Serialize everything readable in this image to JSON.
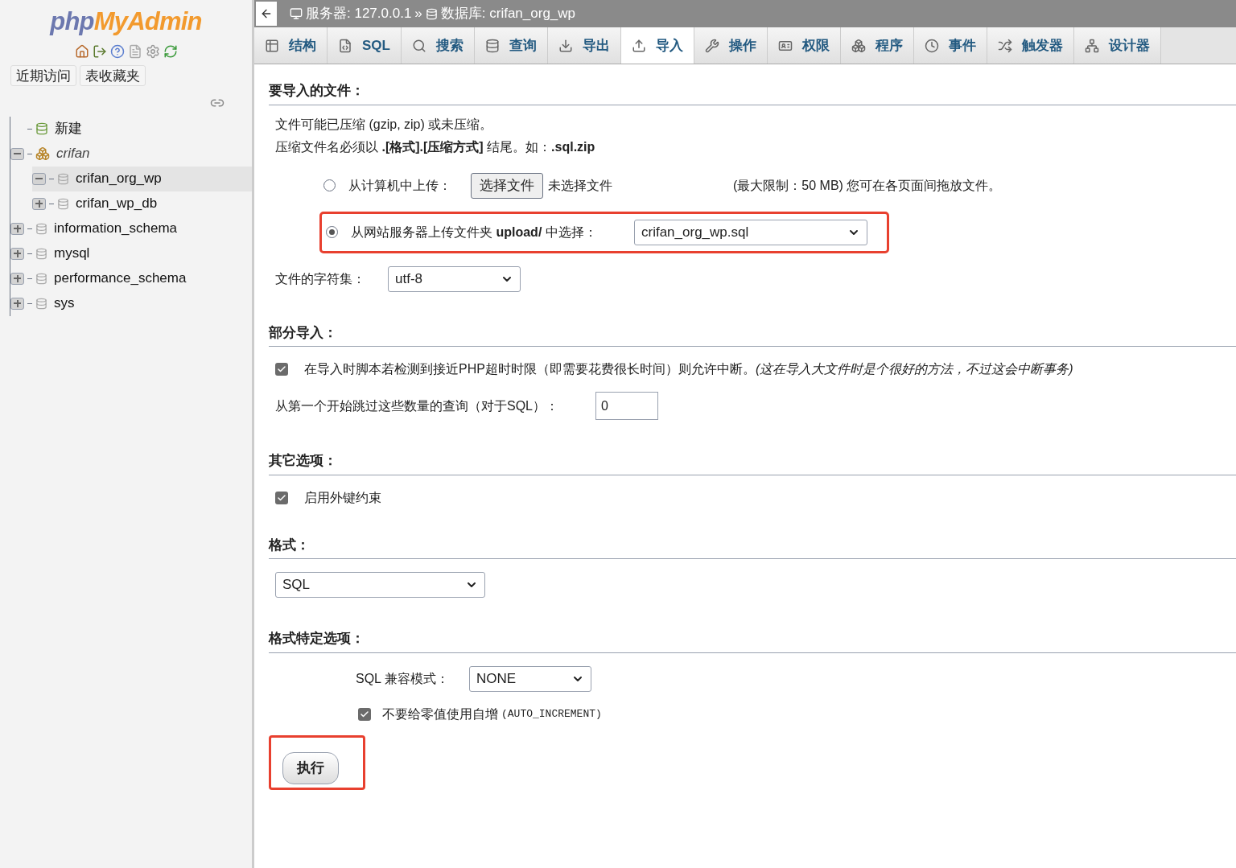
{
  "sidebar": {
    "logo": {
      "part1": "php",
      "part2": "MyAdmin"
    },
    "buttons": [
      "近期访问",
      "表收藏夹"
    ],
    "tree": [
      {
        "kind": "new",
        "label": "新建",
        "italic": false,
        "selected": false
      },
      {
        "kind": "group",
        "label": "crifan",
        "italic": true,
        "expanded": true,
        "selected": false,
        "children": [
          {
            "kind": "db",
            "label": "crifan_org_wp",
            "italic": false,
            "expanded": true,
            "selected": true
          },
          {
            "kind": "db",
            "label": "crifan_wp_db",
            "italic": false,
            "expanded": false,
            "selected": false
          }
        ]
      },
      {
        "kind": "db",
        "label": "information_schema",
        "italic": false,
        "expanded": false,
        "selected": false
      },
      {
        "kind": "db",
        "label": "mysql",
        "italic": false,
        "expanded": false,
        "selected": false
      },
      {
        "kind": "db",
        "label": "performance_schema",
        "italic": false,
        "expanded": false,
        "selected": false
      },
      {
        "kind": "db",
        "label": "sys",
        "italic": false,
        "expanded": false,
        "selected": false
      }
    ]
  },
  "breadcrumb": {
    "server": "服务器: 127.0.0.1",
    "separator": "»",
    "database": "数据库: crifan_org_wp"
  },
  "tabs": [
    {
      "label": "结构",
      "selected": false
    },
    {
      "label": "SQL",
      "selected": false
    },
    {
      "label": "搜索",
      "selected": false
    },
    {
      "label": "查询",
      "selected": false
    },
    {
      "label": "导出",
      "selected": false
    },
    {
      "label": "导入",
      "selected": true
    },
    {
      "label": "操作",
      "selected": false
    },
    {
      "label": "权限",
      "selected": false
    },
    {
      "label": "程序",
      "selected": false
    },
    {
      "label": "事件",
      "selected": false
    },
    {
      "label": "触发器",
      "selected": false
    },
    {
      "label": "设计器",
      "selected": false
    }
  ],
  "file_section": {
    "title": "要导入的文件：",
    "notes": [
      "文件可能已压缩 (gzip, zip) 或未压缩。",
      "压缩文件名必须以 **.[格式].[压缩方式]** 结尾。如：**.sql.zip**"
    ],
    "upload_local": {
      "label": "从计算机中上传：",
      "selected": false,
      "button": "选择文件",
      "file_status": "未选择文件",
      "limit": "(最大限制：50 MB) 您可在各页面间拖放文件。"
    },
    "upload_server": {
      "label": "从网站服务器上传文件夹 **upload/** 中选择：",
      "selected": true,
      "highlighted": true,
      "value": "crifan_org_wp.sql"
    },
    "charset": {
      "label": "文件的字符集：",
      "value": "utf-8"
    }
  },
  "partial_section": {
    "title": "部分导入：",
    "allow_interrupt": {
      "checked": true,
      "label": "在导入时脚本若检测到接近PHP超时时限（即需要花费很长时间）则允许中断。*(这在导入大文件时是个很好的方法，不过这会中断事务)*"
    },
    "skip": {
      "label": "从第一个开始跳过这些数量的查询（对于SQL）：",
      "value": "0"
    }
  },
  "other_section": {
    "title": "其它选项：",
    "foreign_keys": {
      "checked": true,
      "label": "启用外键约束"
    }
  },
  "format_section": {
    "title": "格式：",
    "value": "SQL"
  },
  "format_options_section": {
    "title": "格式特定选项：",
    "compat": {
      "label": "SQL 兼容模式：",
      "value": "NONE"
    },
    "no_auto_value": {
      "checked": true,
      "label": "不要给零值使用自增",
      "code": "(AUTO_INCREMENT)"
    }
  },
  "go_button": {
    "label": "执行",
    "highlighted": true
  }
}
